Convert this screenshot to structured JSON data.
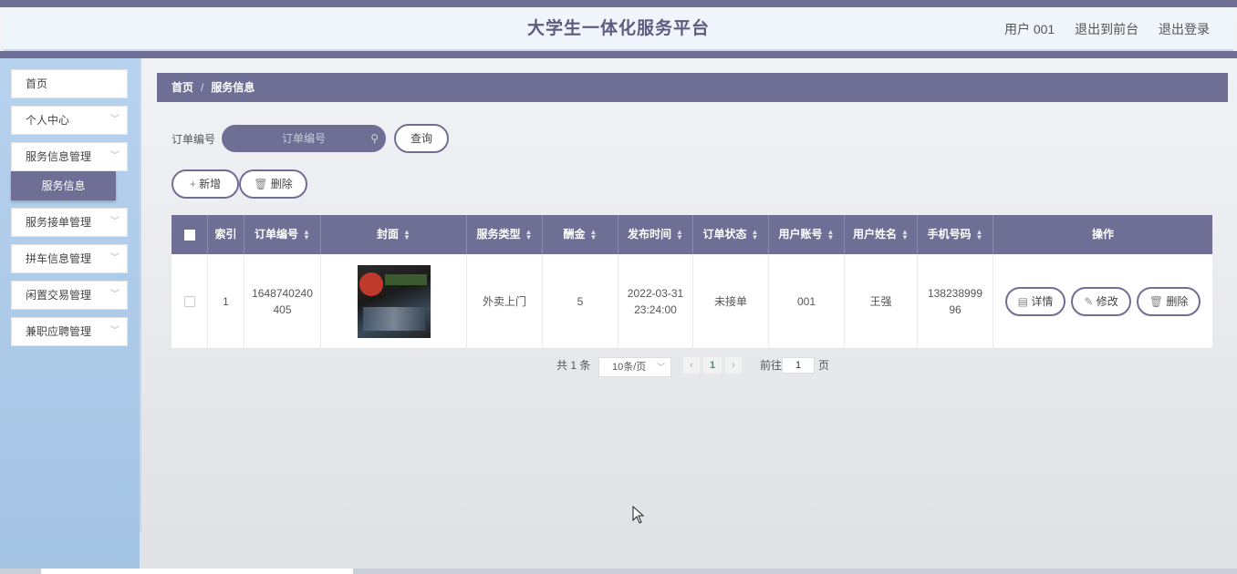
{
  "header": {
    "title": "大学生一体化服务平台",
    "user": "用户 001",
    "link_frontend": "退出到前台",
    "link_logout": "退出登录"
  },
  "sidebar": {
    "items": [
      {
        "label": "首页"
      },
      {
        "label": "个人中心"
      },
      {
        "label": "服务信息管理"
      },
      {
        "label": "服务接单管理"
      },
      {
        "label": "拼车信息管理"
      },
      {
        "label": "闲置交易管理"
      },
      {
        "label": "兼职应聘管理"
      }
    ],
    "active_sub": "服务信息"
  },
  "breadcrumb": {
    "home": "首页",
    "sep": "/",
    "current": "服务信息"
  },
  "search": {
    "label": "订单编号",
    "placeholder": "订单编号",
    "button": "查询"
  },
  "toolbar": {
    "add": "新增",
    "delete": "删除"
  },
  "table": {
    "headers": [
      "索引",
      "订单编号",
      "封面",
      "服务类型",
      "酬金",
      "发布时间",
      "订单状态",
      "用户账号",
      "用户姓名",
      "手机号码",
      "操作"
    ],
    "rows": [
      {
        "index": "1",
        "order_no_line1": "1648740240",
        "order_no_line2": "405",
        "service_type": "外卖上门",
        "reward": "5",
        "publish_date": "2022-03-31",
        "publish_time": "23:24:00",
        "status": "未接单",
        "account": "001",
        "name": "王强",
        "phone_line1": "138238999",
        "phone_line2": "96",
        "actions": {
          "detail": "详情",
          "edit": "修改",
          "delete": "删除"
        }
      }
    ]
  },
  "pager": {
    "total": "共 1 条",
    "page_size": "10条/页",
    "current": "1",
    "goto_label": "前往",
    "goto_value": "1",
    "page_suffix": "页"
  }
}
